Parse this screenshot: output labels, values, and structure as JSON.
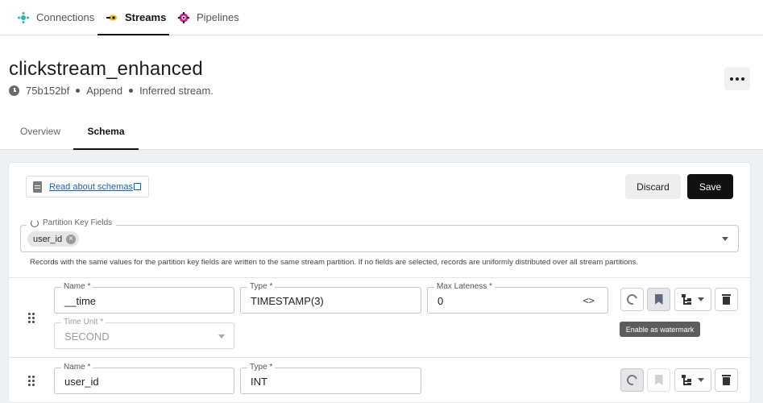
{
  "nav": {
    "tabs": [
      {
        "label": "Connections",
        "icon": "connections-icon"
      },
      {
        "label": "Streams",
        "icon": "streams-icon",
        "active": true
      },
      {
        "label": "Pipelines",
        "icon": "pipelines-icon"
      }
    ]
  },
  "header": {
    "title": "clickstream_enhanced",
    "id": "75b152bf",
    "mode": "Append",
    "kind": "Inferred stream."
  },
  "subtabs": [
    {
      "label": "Overview"
    },
    {
      "label": "Schema",
      "active": true
    }
  ],
  "toolbar": {
    "read_link": "Read about schemas",
    "discard_label": "Discard",
    "save_label": "Save"
  },
  "partition": {
    "label": "Partition Key Fields",
    "chips": [
      "user_id"
    ],
    "helper": "Records with the same values for the partition key fields are written to the same stream partition. If no fields are selected, records are uniformly distributed over all stream partitions."
  },
  "fields": [
    {
      "name_label": "Name *",
      "name": "__time",
      "type_label": "Type *",
      "type": "TIMESTAMP(3)",
      "lateness_label": "Max Lateness *",
      "lateness": "0",
      "unit_label": "Time Unit *",
      "unit": "SECOND",
      "watermark_tooltip": "Enable as watermark"
    },
    {
      "name_label": "Name *",
      "name": "user_id",
      "type_label": "Type *",
      "type": "INT"
    }
  ],
  "colors": {
    "accent": "#111111",
    "link": "#1a5fb4",
    "panel_bg": "#eef1f4"
  }
}
